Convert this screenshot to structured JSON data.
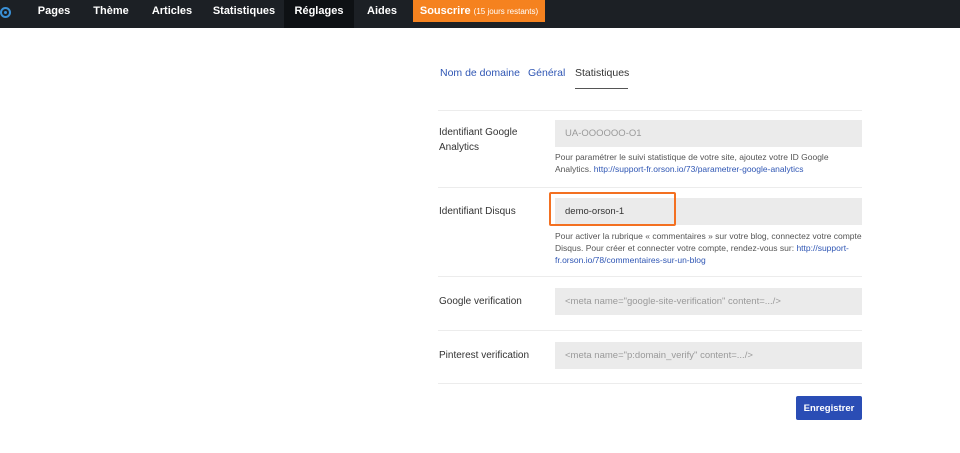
{
  "nav": {
    "items": [
      {
        "label": "Pages",
        "active": false
      },
      {
        "label": "Thème",
        "active": false
      },
      {
        "label": "Articles",
        "active": false
      },
      {
        "label": "Statistiques",
        "active": false
      },
      {
        "label": "Réglages",
        "active": true
      },
      {
        "label": "Aides",
        "active": false
      }
    ],
    "subscribe": {
      "label": "Souscrire",
      "trial": "(15 jours restants)"
    }
  },
  "tabs": [
    {
      "label": "Nom de domaine",
      "active": false
    },
    {
      "label": "Général",
      "active": false
    },
    {
      "label": "Statistiques",
      "active": true
    }
  ],
  "form": {
    "google_analytics": {
      "label": "Identifiant Google Analytics",
      "value": "",
      "placeholder": "UA-OOOOOO-O1",
      "help": "Pour paramétrer le suivi statistique de votre site, ajoutez votre ID Google Analytics.",
      "link": "http://support-fr.orson.io/73/parametrer-google-analytics"
    },
    "disqus": {
      "label": "Identifiant Disqus",
      "value": "demo-orson-1",
      "placeholder": "",
      "help": "Pour activer la rubrique « commentaires » sur votre blog, connectez votre compte Disqus. Pour créer et connecter votre compte, rendez-vous sur:",
      "link": "http://support-fr.orson.io/78/commentaires-sur-un-blog"
    },
    "google_verification": {
      "label": "Google verification",
      "value": "",
      "placeholder": "<meta name=\"google-site-verification\" content=.../>"
    },
    "pinterest_verification": {
      "label": "Pinterest verification",
      "value": "",
      "placeholder": "<meta name=\"p:domain_verify\" content=.../>"
    }
  },
  "save_label": "Enregistrer",
  "colors": {
    "topbar": "#1c2025",
    "subscribe": "#f5821f",
    "link": "#2f56b4",
    "highlight": "#f37021",
    "button": "#2a4db5"
  }
}
